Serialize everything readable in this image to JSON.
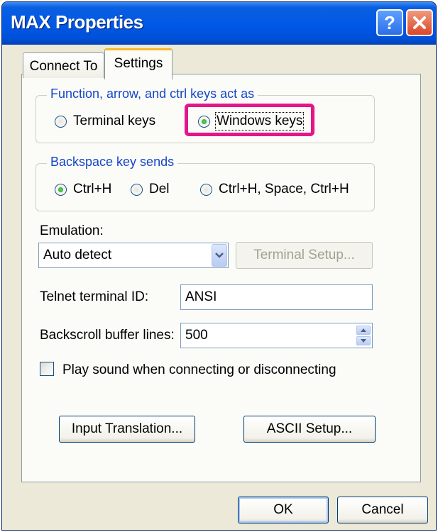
{
  "window": {
    "title": "MAX Properties",
    "help_glyph": "?"
  },
  "tabs": [
    {
      "label": "Connect To"
    },
    {
      "label": "Settings"
    }
  ],
  "keys_group": {
    "legend": "Function, arrow, and ctrl keys act as",
    "options": [
      {
        "label": "Terminal keys",
        "selected": false
      },
      {
        "label": "Windows keys",
        "selected": true
      }
    ]
  },
  "backspace_group": {
    "legend": "Backspace key sends",
    "options": [
      {
        "label": "Ctrl+H",
        "selected": true
      },
      {
        "label": "Del",
        "selected": false
      },
      {
        "label": "Ctrl+H, Space, Ctrl+H",
        "selected": false
      }
    ]
  },
  "emulation": {
    "label": "Emulation:",
    "value": "Auto detect",
    "setup_button": "Terminal Setup..."
  },
  "telnet": {
    "label": "Telnet terminal ID:",
    "value": "ANSI"
  },
  "backscroll": {
    "label": "Backscroll buffer lines:",
    "value": "500"
  },
  "play_sound": {
    "label": "Play sound when connecting or disconnecting",
    "checked": false
  },
  "buttons": {
    "input_translation": "Input Translation...",
    "ascii_setup": "ASCII Setup...",
    "ok": "OK",
    "cancel": "Cancel"
  },
  "colors": {
    "title_bar": "#0058e6",
    "highlight": "#e4168a",
    "legend_text": "#1646c8",
    "dialog_bg": "#ece9d8"
  }
}
